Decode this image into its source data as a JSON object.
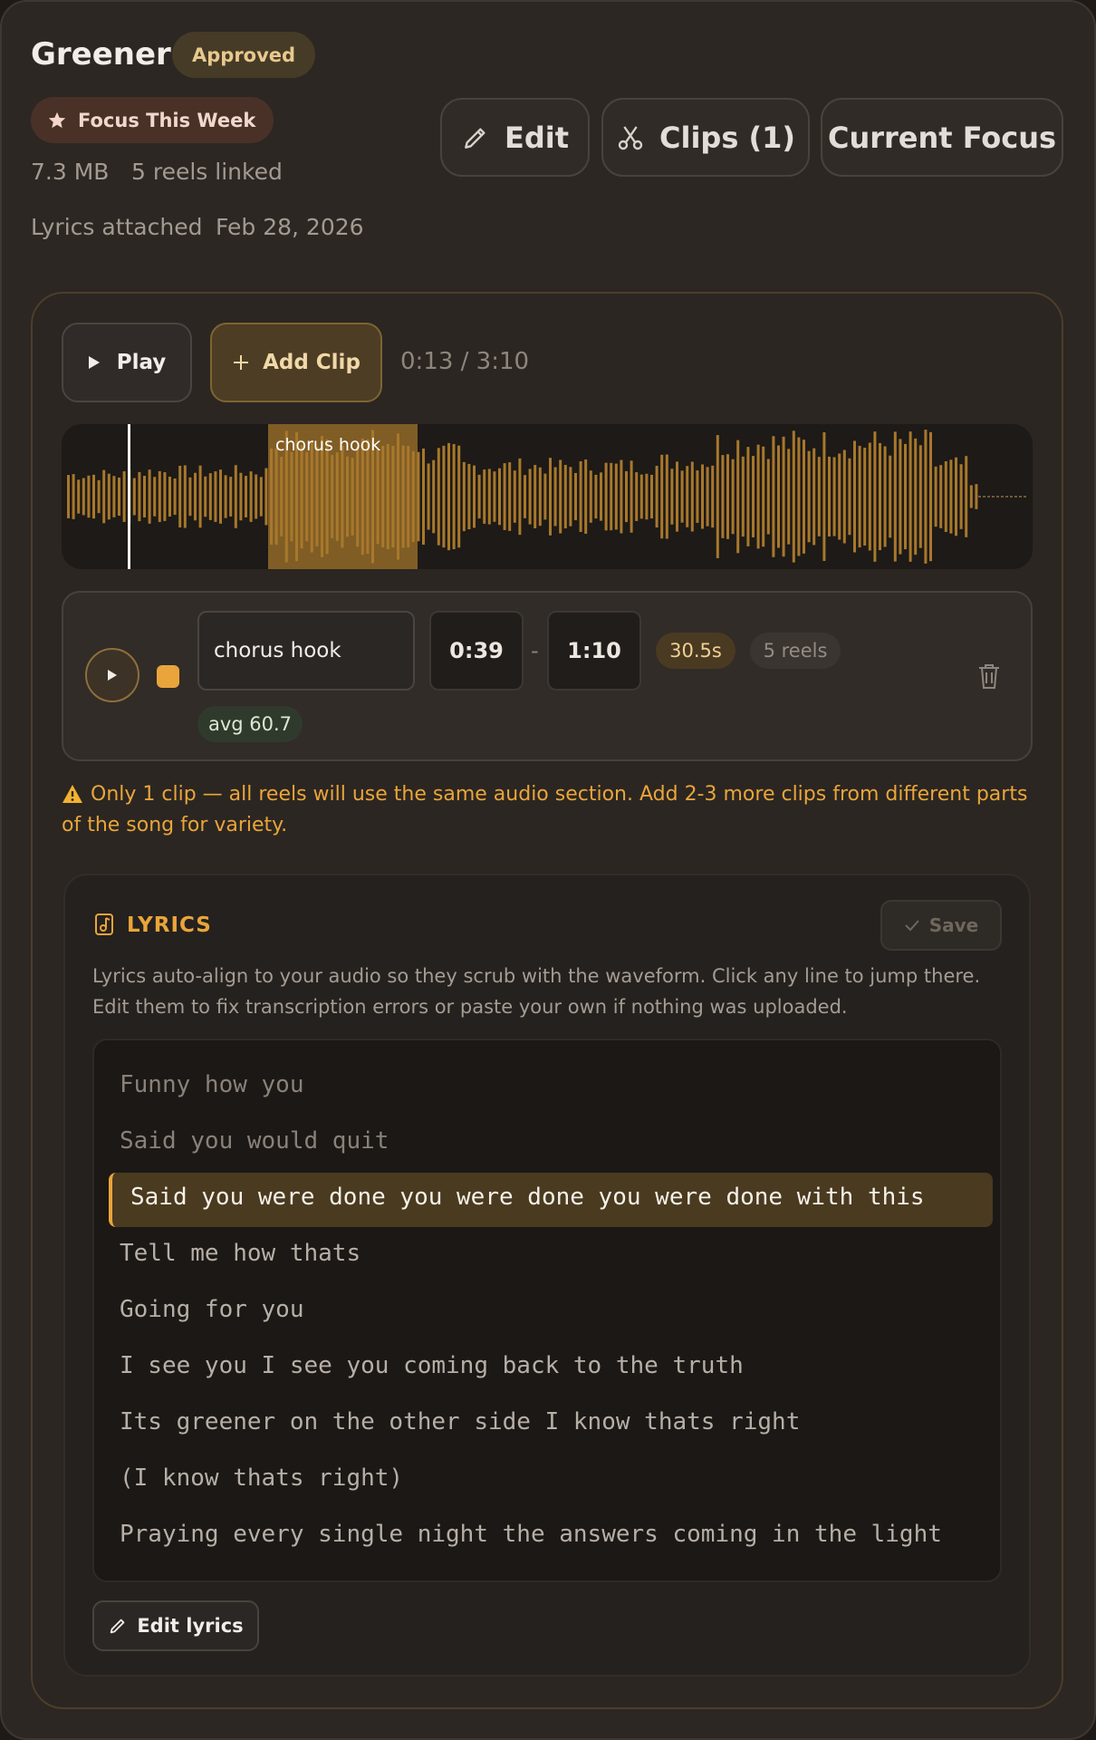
{
  "song": {
    "title": "Greener",
    "status_badge": "Approved",
    "focus_badge": "Focus This Week",
    "file_size": "7.3 MB",
    "reels_linked": "5 reels linked",
    "lyrics_status": "Lyrics attached",
    "date": "Feb 28, 2026"
  },
  "actions": {
    "edit_label": "Edit",
    "clips_label": "Clips (1)",
    "current_focus_label": "Current Focus"
  },
  "player": {
    "play_label": "Play",
    "add_clip_label": "Add Clip",
    "time_display": "0:13 / 3:10",
    "region_label": "chorus hook",
    "playhead_fraction": 0.068
  },
  "clip": {
    "name": "chorus hook",
    "start": "0:39",
    "end": "1:10",
    "duration": "30.5s",
    "reels": "5 reels",
    "avg": "avg 60.7",
    "color": "#e9a53c"
  },
  "warning": {
    "text": "Only 1 clip — all reels will use the same audio section. Add 2-3 more clips from different parts of the song for variety."
  },
  "lyrics": {
    "heading": "LYRICS",
    "save_label": "Save",
    "help_text": "Lyrics auto-align to your audio so they scrub with the waveform. Click any line to jump there. Edit them to fix transcription errors or paste your own if nothing was uploaded.",
    "lines": [
      "Funny how you",
      "Said you would quit",
      "Said you were done you were done you were done with this",
      "Tell me how thats",
      "Going for you",
      "I see you I see you coming back to the truth",
      "Its greener on the other side I know thats right",
      "(I know thats right)",
      "Praying every single night the answers coming in the light"
    ],
    "edit_label": "Edit lyrics"
  },
  "colors": {
    "accent": "#e9a53a",
    "waveform": "#a8782c",
    "warning": "#eaa53a"
  }
}
